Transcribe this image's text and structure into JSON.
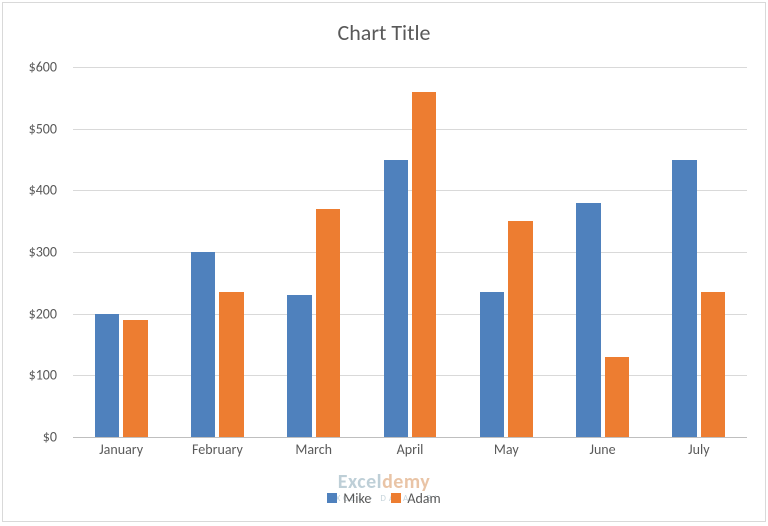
{
  "chart_data": {
    "type": "bar",
    "title": "Chart Title",
    "xlabel": "",
    "ylabel": "",
    "ylim": [
      0,
      600
    ],
    "ystep": 100,
    "yprefix": "$",
    "categories": [
      "January",
      "February",
      "March",
      "April",
      "May",
      "June",
      "July"
    ],
    "series": [
      {
        "name": "Mike",
        "color": "#4f81bd",
        "values": [
          200,
          300,
          230,
          450,
          235,
          380,
          450
        ]
      },
      {
        "name": "Adam",
        "color": "#ed7d31",
        "values": [
          190,
          235,
          370,
          560,
          350,
          130,
          235
        ]
      }
    ],
    "legend_position": "bottom",
    "grid": true
  },
  "watermark": {
    "line1_a": "Excel",
    "line1_b": "demy",
    "line2": "EXCEL · DATA · BI"
  }
}
